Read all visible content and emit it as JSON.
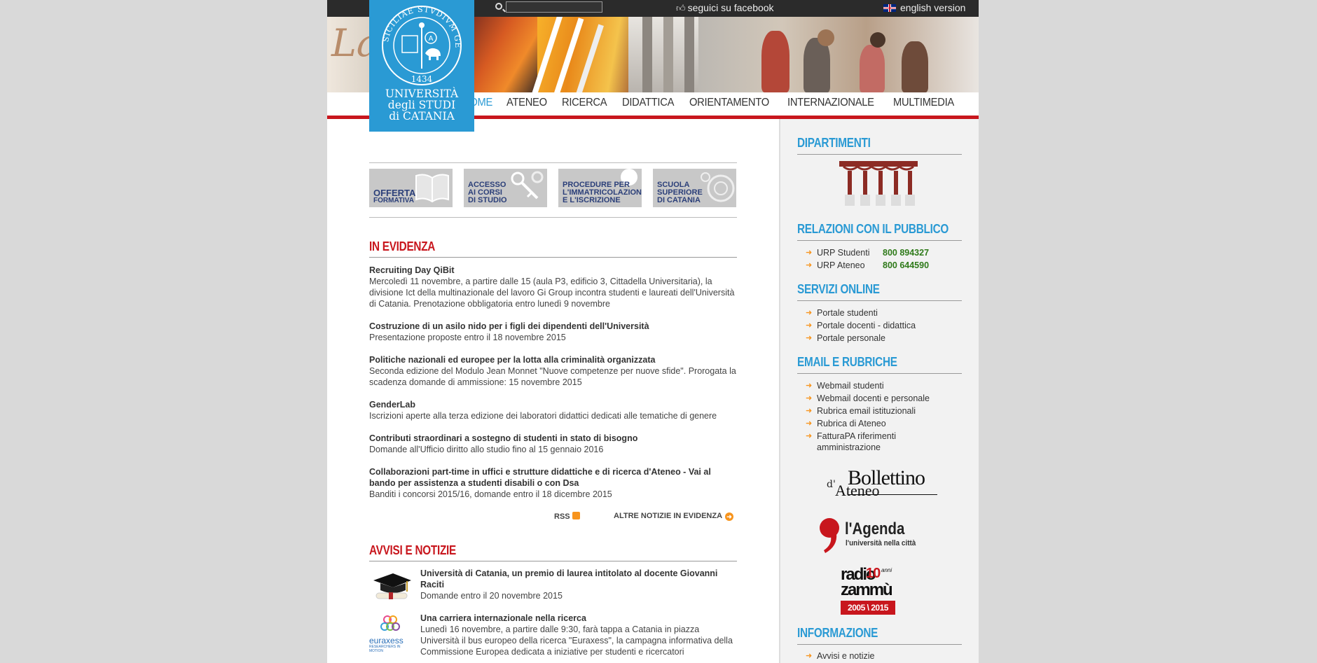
{
  "topbar": {
    "search_placeholder": "",
    "facebook_label": "seguici su facebook",
    "english_label": "english version"
  },
  "logo": {
    "seal_text": "SICILIAE STVDIVM GENERALE",
    "seal_year": "1434",
    "line1": "UNIVERSITÀ",
    "line2": "degli STUDI",
    "line3": "di CATANIA"
  },
  "nav": {
    "items": [
      "HOME",
      "ATENEO",
      "RICERCA",
      "DIDATTICA",
      "ORIENTAMENTO",
      "INTERNAZIONALE",
      "MULTIMEDIA"
    ],
    "active": "HOME"
  },
  "quick_links": [
    {
      "lines": [
        "OFFERTA",
        "FORMATIVA"
      ]
    },
    {
      "lines": [
        "ACCESSO",
        "AI CORSI",
        "DI STUDIO"
      ]
    },
    {
      "lines": [
        "PROCEDURE PER",
        "L'IMMATRICOLAZIONE",
        "E L'ISCRIZIONE"
      ]
    },
    {
      "lines": [
        "SCUOLA",
        "SUPERIORE",
        "DI CATANIA"
      ]
    }
  ],
  "evidenza": {
    "title": "IN EVIDENZA",
    "items": [
      {
        "title": "Recruiting Day QiBit",
        "desc": "Mercoledì 11 novembre, a partire dalle 15 (aula P3, edificio 3, Cittadella Universitaria), la divisione Ict della multinazionale del lavoro Gi Group incontra studenti e laureati dell'Università di Catania. Prenotazione obbligatoria entro lunedì 9 novembre"
      },
      {
        "title": "Costruzione di un asilo nido per i figli dei dipendenti dell'Università",
        "desc": "Presentazione proposte entro il 18 novembre 2015"
      },
      {
        "title": "Politiche nazionali ed europee per la lotta alla criminalità organizzata",
        "desc": "Seconda edizione del Modulo Jean Monnet \"Nuove competenze per nuove sfide\". Prorogata la scadenza domande di ammissione: 15 novembre 2015"
      },
      {
        "title": "GenderLab",
        "desc": "Iscrizioni aperte alla terza edizione dei laboratori didattici dedicati alle tematiche di genere"
      },
      {
        "title": "Contributi straordinari a sostegno di studenti in stato di bisogno",
        "desc": "Domande all'Ufficio diritto allo studio fino al 15 gennaio 2016"
      },
      {
        "title": "Collaborazioni part-time in uffici e strutture didattiche e di ricerca d'Ateneo - Vai al bando per assistenza a studenti disabili o con Dsa",
        "desc": "Banditi i concorsi 2015/16, domande entro il 18 dicembre 2015"
      }
    ],
    "rss_label": "RSS",
    "more_label": "ALTRE NOTIZIE IN EVIDENZA"
  },
  "avvisi": {
    "title": "AVVISI E NOTIZIE",
    "items": [
      {
        "title": "Università di Catania, un premio di laurea intitolato al docente Giovanni Raciti",
        "desc": "Domande entro il 20 novembre 2015"
      },
      {
        "title": "Una carriera internazionale nella ricerca",
        "desc": "Lunedì 16 novembre, a partire dalle 9:30, farà tappa a Catania in piazza Università il bus europeo della ricerca \"Euraxess\", la campagna informativa della Commissione Europea dedicata a iniziative per studenti e ricercatori"
      }
    ],
    "euraxess_logo": "euraxess",
    "euraxess_tagline": "RESEARCHERS IN MOTION"
  },
  "sidebar": {
    "dipartimenti_title": "DIPARTIMENTI",
    "relazioni_title": "RELAZIONI CON IL PUBBLICO",
    "urp": [
      {
        "label": "URP Studenti",
        "phone": "800 894327"
      },
      {
        "label": "URP Ateneo",
        "phone": "800 644590"
      }
    ],
    "servizi_title": "SERVIZI ONLINE",
    "servizi": [
      "Portale studenti",
      "Portale docenti - didattica",
      "Portale personale"
    ],
    "email_title": "EMAIL E RUBRICHE",
    "email": [
      "Webmail studenti",
      "Webmail docenti e personale",
      "Rubrica email istituzionali",
      "Rubrica di Ateneo",
      "FatturaPA riferimenti amministrazione"
    ],
    "bollettino": {
      "small": "d'",
      "big": "Bollettino",
      "sub": "Ateneo"
    },
    "agenda": {
      "title": "l'Agenda",
      "subtitle": "l'università nella città"
    },
    "radio": {
      "line1": "radio",
      "line2": "zammù",
      "ten": "10",
      "anni": "anni",
      "years": "2005 \\ 2015"
    },
    "informazione_title": "INFORMAZIONE",
    "informazione": [
      "Avvisi e notizie"
    ]
  },
  "colors": {
    "accent_blue": "#2a9ad4",
    "accent_red": "#c8161d",
    "phone_green": "#2f7a1a",
    "arrow_orange": "#f7941d"
  }
}
